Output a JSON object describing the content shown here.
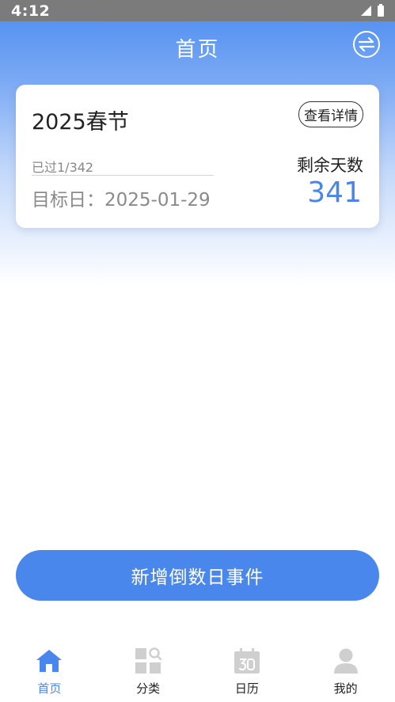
{
  "status_bar": {
    "time": "4:12"
  },
  "header": {
    "title": "首页"
  },
  "card": {
    "event_name": "2025春节",
    "detail_label": "查看详情",
    "passed_text": "已过1/342",
    "target_date_text": "目标日：2025-01-29",
    "remaining_label": "剩余天数",
    "remaining_days": "341"
  },
  "add_button": {
    "label": "新增倒数日事件"
  },
  "nav": {
    "items": [
      {
        "label": "首页",
        "icon": "home-icon",
        "active": true
      },
      {
        "label": "分类",
        "icon": "category-icon",
        "active": false
      },
      {
        "label": "日历",
        "icon": "calendar-icon",
        "active": false
      },
      {
        "label": "我的",
        "icon": "profile-icon",
        "active": false
      }
    ]
  },
  "colors": {
    "accent": "#4a87ed",
    "inactive_icon": "#cfcfcf",
    "status_bar": "#7b7b7b"
  }
}
